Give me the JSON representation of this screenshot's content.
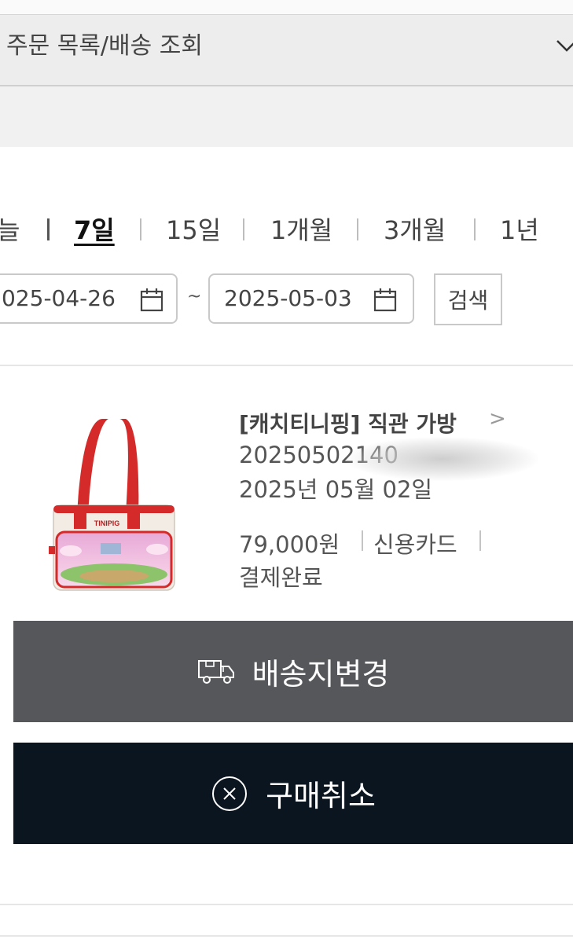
{
  "header": {
    "title": "주문 목록/배송 조회"
  },
  "period_filter": {
    "options": [
      {
        "label": "늘"
      },
      {
        "label": "7일"
      },
      {
        "label": "15일"
      },
      {
        "label": "1개월"
      },
      {
        "label": "3개월"
      },
      {
        "label": "1년"
      }
    ],
    "selected": "7일"
  },
  "date_range": {
    "start": "025-04-26",
    "separator": "~",
    "end": "2025-05-03",
    "search_label": "검색"
  },
  "order": {
    "product_name": "[캐치티니핑] 직관 가방",
    "arrow": ">",
    "order_number_visible": "20250502140",
    "order_date": "2025년 05월 02일",
    "price": "79,000원",
    "payment_method": "신용카드",
    "status": "결제완료",
    "thumbnail_text": "TINIPIG"
  },
  "actions": {
    "change_address_label": "배송지변경",
    "change_address_icon": "delivery-truck-icon",
    "cancel_label": "구매취소",
    "cancel_icon": "close-circle-icon"
  },
  "colors": {
    "header_bg": "#ededed",
    "change_address_bg": "#55575b",
    "cancel_bg": "#0b1520"
  }
}
